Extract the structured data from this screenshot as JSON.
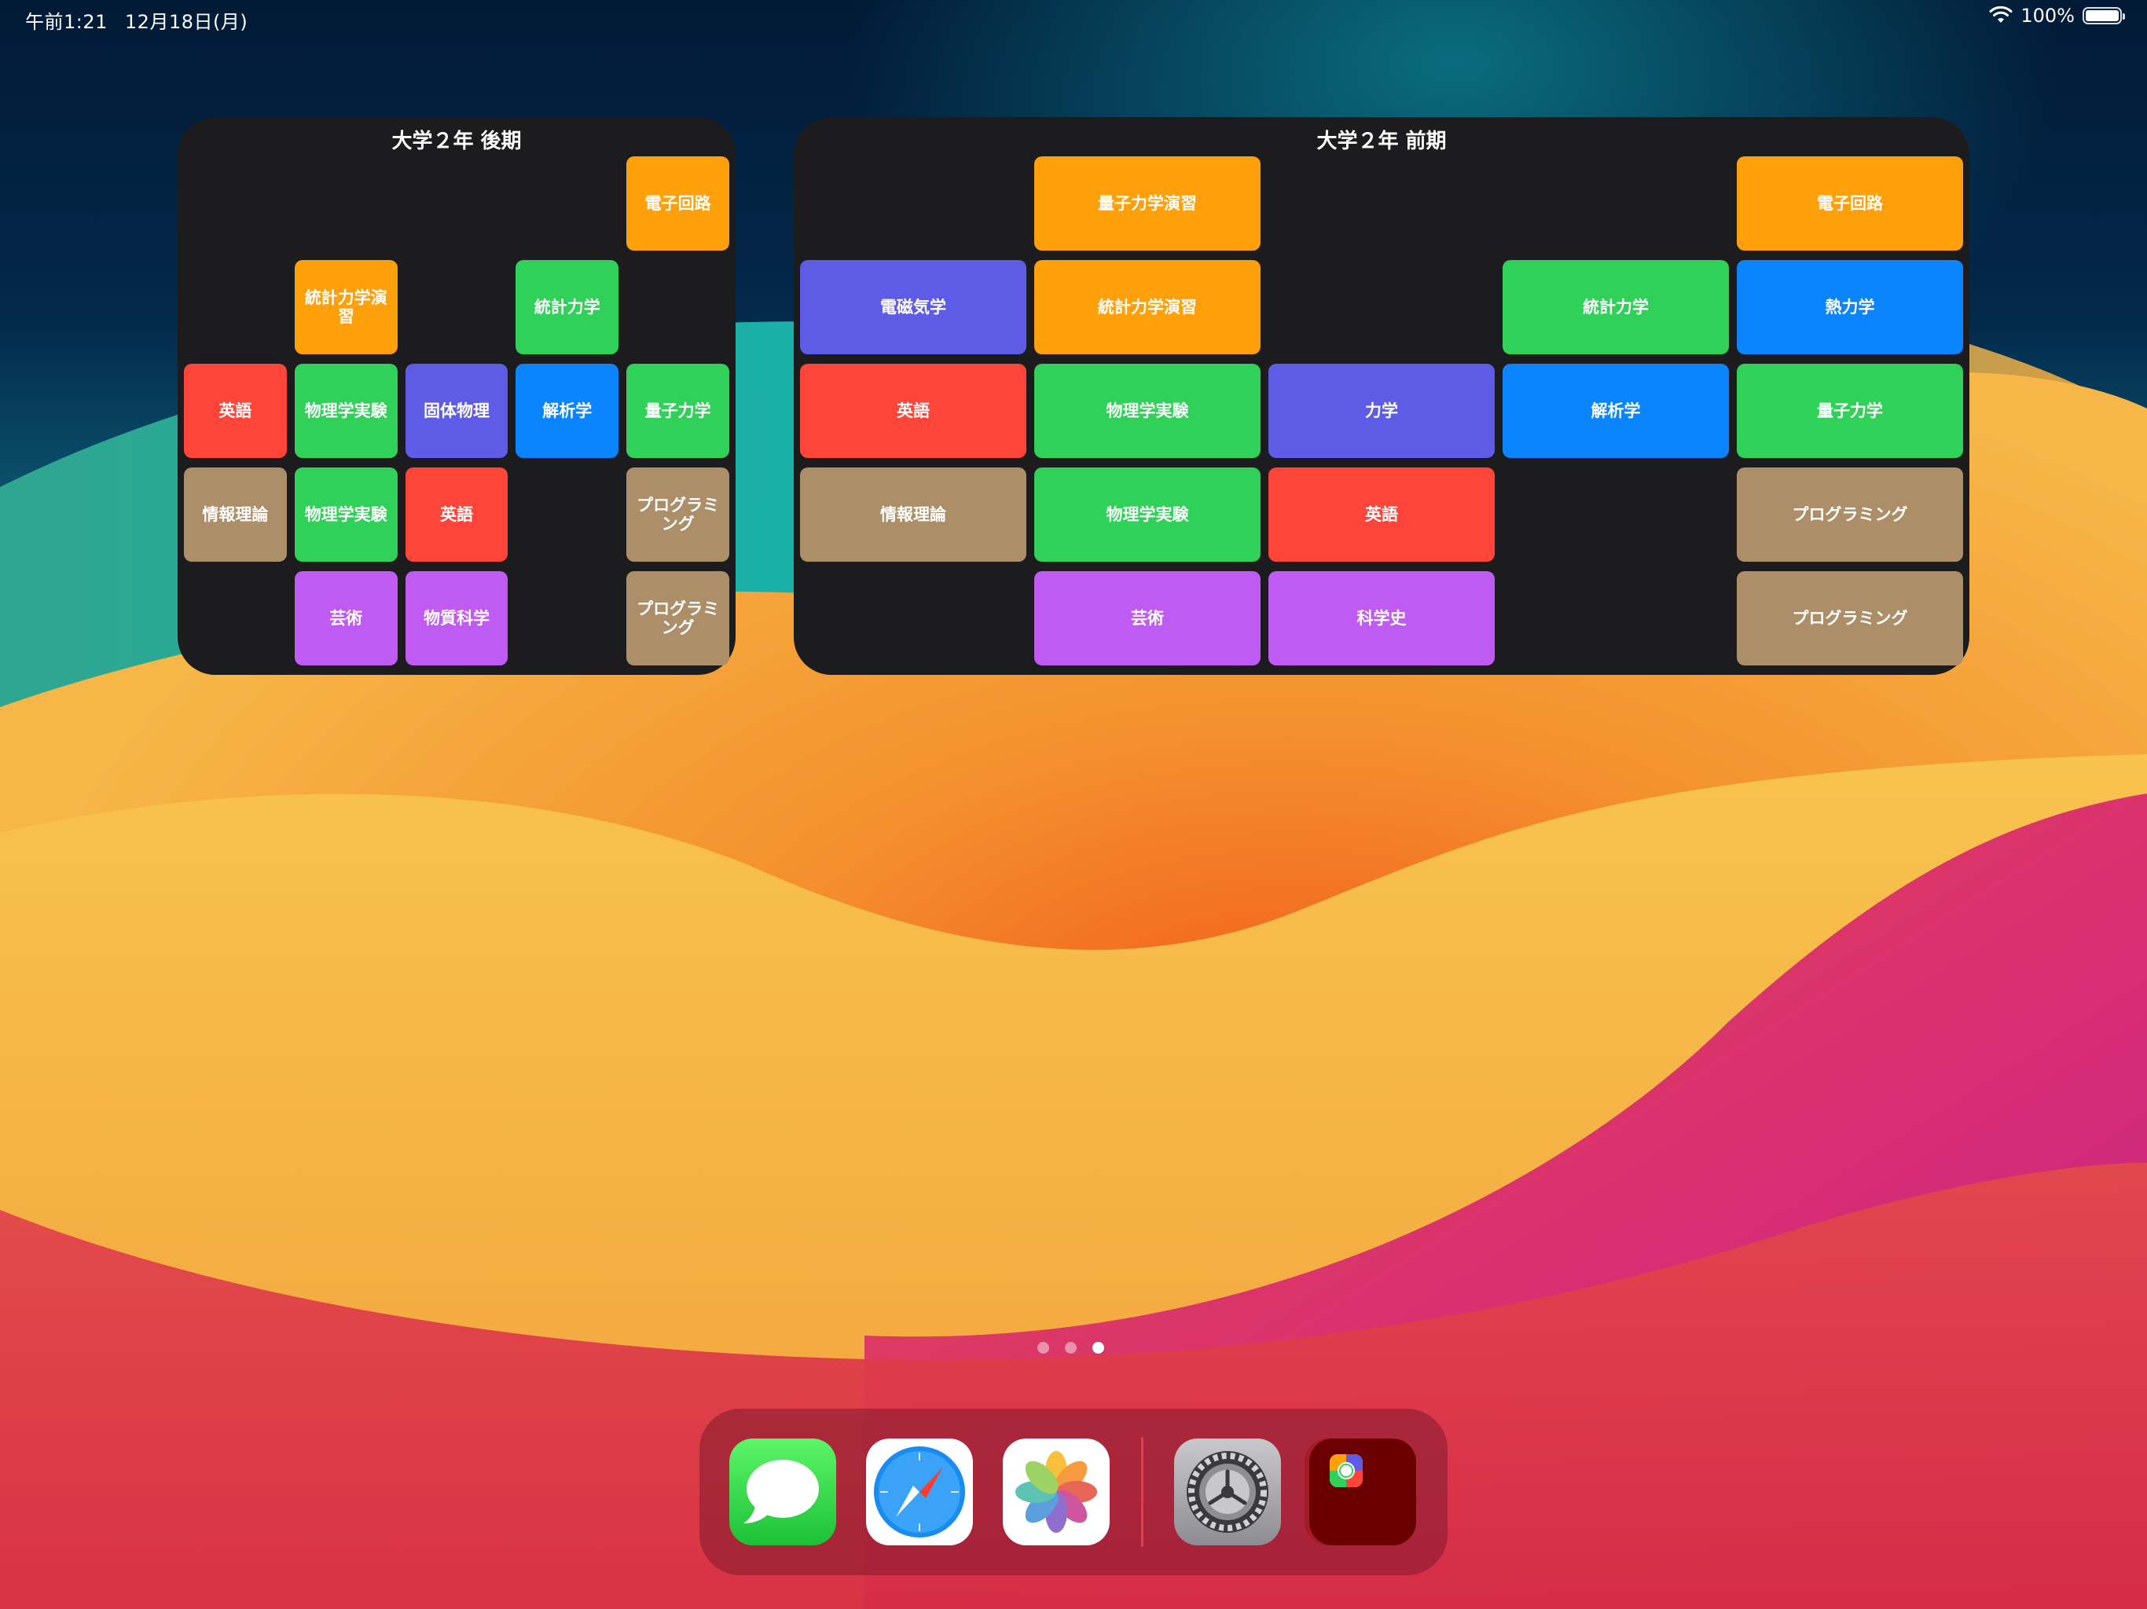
{
  "status_bar": {
    "time": "午前1:21",
    "date": "12月18日(月)",
    "battery": "100%",
    "battery_level_percent": 100
  },
  "colors": {
    "orange": "#ff9f0a",
    "green": "#30d158",
    "indigo": "#5e5ce6",
    "blue": "#0a84ff",
    "red": "#ff453a",
    "brown": "#ac8e68",
    "purple": "#bf5af2",
    "widget_bg": "#1c1c1e"
  },
  "widgets": [
    {
      "title": "大学２年 後期",
      "columns": 5,
      "cells": [
        {
          "row": 1,
          "col": 5,
          "label": "電子回路",
          "color": "orange"
        },
        {
          "row": 2,
          "col": 2,
          "label": "統計力学演習",
          "color": "orange"
        },
        {
          "row": 2,
          "col": 4,
          "label": "統計力学",
          "color": "green"
        },
        {
          "row": 3,
          "col": 1,
          "label": "英語",
          "color": "red"
        },
        {
          "row": 3,
          "col": 2,
          "label": "物理学実験",
          "color": "green"
        },
        {
          "row": 3,
          "col": 3,
          "label": "固体物理",
          "color": "indigo"
        },
        {
          "row": 3,
          "col": 4,
          "label": "解析学",
          "color": "blue"
        },
        {
          "row": 3,
          "col": 5,
          "label": "量子力学",
          "color": "green"
        },
        {
          "row": 4,
          "col": 1,
          "label": "情報理論",
          "color": "brown"
        },
        {
          "row": 4,
          "col": 2,
          "label": "物理学実験",
          "color": "green"
        },
        {
          "row": 4,
          "col": 3,
          "label": "英語",
          "color": "red"
        },
        {
          "row": 4,
          "col": 5,
          "label": "プログラミング",
          "color": "brown"
        },
        {
          "row": 5,
          "col": 2,
          "label": "芸術",
          "color": "purple"
        },
        {
          "row": 5,
          "col": 3,
          "label": "物質科学",
          "color": "purple"
        },
        {
          "row": 5,
          "col": 5,
          "label": "プログラミング",
          "color": "brown"
        }
      ]
    },
    {
      "title": "大学２年 前期",
      "columns": 5,
      "cells": [
        {
          "row": 1,
          "col": 2,
          "label": "量子力学演習",
          "color": "orange"
        },
        {
          "row": 1,
          "col": 5,
          "label": "電子回路",
          "color": "orange"
        },
        {
          "row": 2,
          "col": 1,
          "label": "電磁気学",
          "color": "indigo"
        },
        {
          "row": 2,
          "col": 2,
          "label": "統計力学演習",
          "color": "orange"
        },
        {
          "row": 2,
          "col": 4,
          "label": "統計力学",
          "color": "green"
        },
        {
          "row": 2,
          "col": 5,
          "label": "熱力学",
          "color": "blue"
        },
        {
          "row": 3,
          "col": 1,
          "label": "英語",
          "color": "red"
        },
        {
          "row": 3,
          "col": 2,
          "label": "物理学実験",
          "color": "green"
        },
        {
          "row": 3,
          "col": 3,
          "label": "力学",
          "color": "indigo"
        },
        {
          "row": 3,
          "col": 4,
          "label": "解析学",
          "color": "blue"
        },
        {
          "row": 3,
          "col": 5,
          "label": "量子力学",
          "color": "green"
        },
        {
          "row": 4,
          "col": 1,
          "label": "情報理論",
          "color": "brown"
        },
        {
          "row": 4,
          "col": 2,
          "label": "物理学実験",
          "color": "green"
        },
        {
          "row": 4,
          "col": 3,
          "label": "英語",
          "color": "red"
        },
        {
          "row": 4,
          "col": 5,
          "label": "プログラミング",
          "color": "brown"
        },
        {
          "row": 5,
          "col": 2,
          "label": "芸術",
          "color": "purple"
        },
        {
          "row": 5,
          "col": 3,
          "label": "科学史",
          "color": "purple"
        },
        {
          "row": 5,
          "col": 5,
          "label": "プログラミング",
          "color": "brown"
        }
      ]
    }
  ],
  "page_indicator": {
    "count": 3,
    "current": 3
  },
  "dock": {
    "apps": [
      {
        "icon": "messages-icon"
      },
      {
        "icon": "safari-icon"
      },
      {
        "icon": "photos-icon"
      }
    ],
    "recent_apps": [
      {
        "icon": "settings-icon"
      },
      {
        "icon": "app-folder-icon"
      }
    ]
  }
}
